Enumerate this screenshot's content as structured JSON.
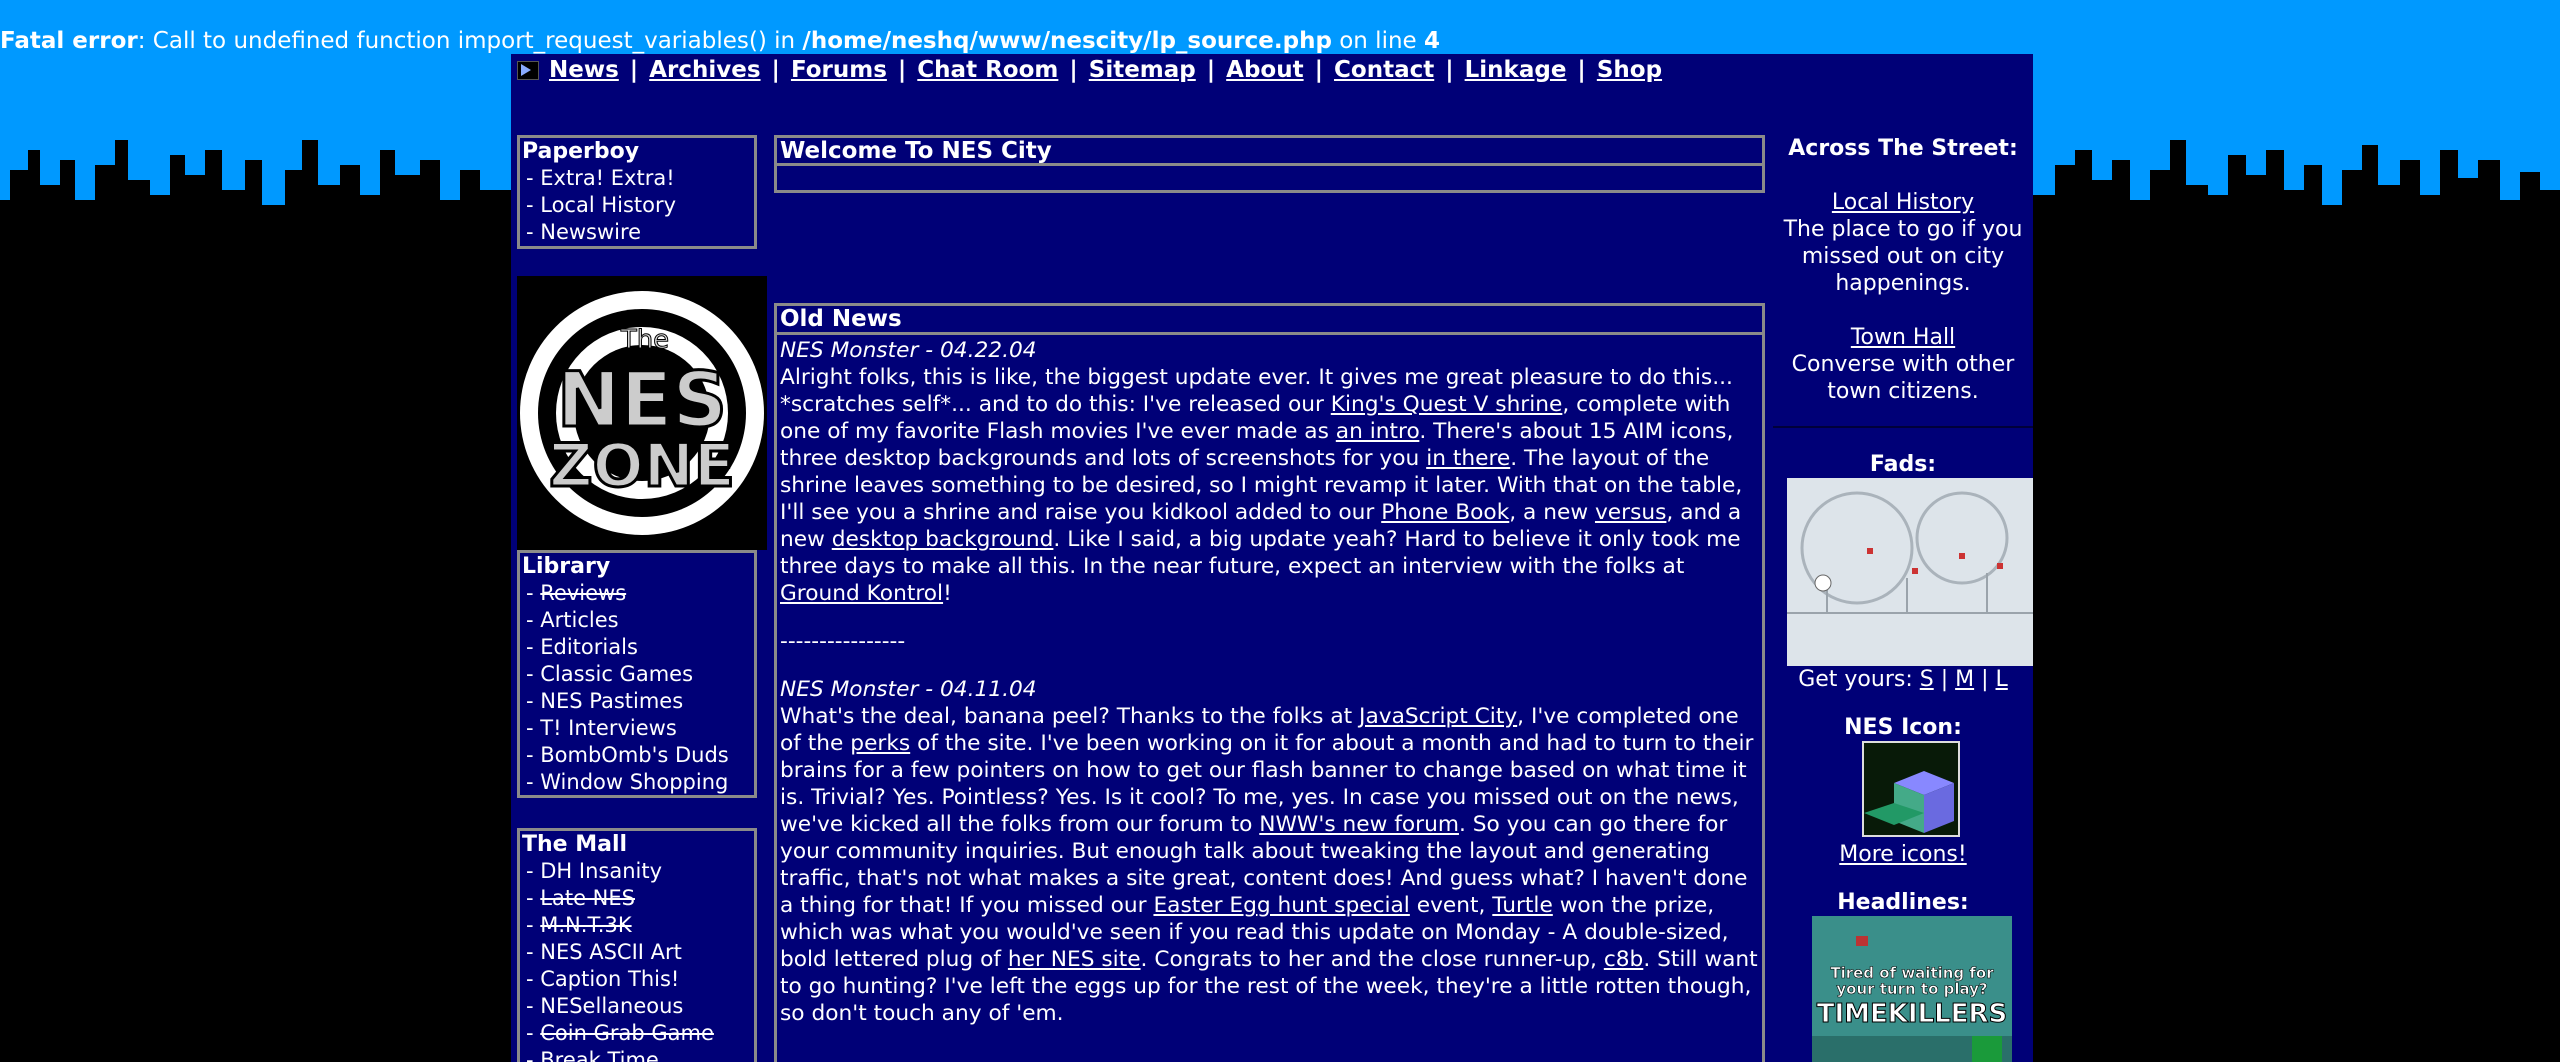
{
  "error": {
    "prefix": "Fatal error",
    "message": ": Call to undefined function import_request_variables() in ",
    "file": "/home/neshq/www/nescity/lp_source.php",
    "online": " on line ",
    "line": "4"
  },
  "nav": [
    "News",
    "Archives",
    "Forums",
    "Chat Room",
    "Sitemap",
    "About",
    "Contact",
    "Linkage",
    "Shop"
  ],
  "paperboy": {
    "title": "Paperboy",
    "items": [
      "- Extra! Extra!",
      "- Local History",
      "- Newswire"
    ]
  },
  "logo": {
    "line1": "The",
    "line2": "NES",
    "line3": "ZONE"
  },
  "library": {
    "title": "Library",
    "items": [
      "- ",
      "Reviews",
      "- Articles",
      "- Editorials",
      "- Classic Games",
      "- NES Pastimes",
      "- T! Interviews",
      "- BombOmb's Duds",
      "- Window Shopping"
    ]
  },
  "mall": {
    "title": "The Mall",
    "items": [
      "- DH Insanity",
      "- ",
      "Late NES",
      "- ",
      "M.N.T.3K",
      "- NES ASCII Art",
      "- Caption This!",
      "- NESellaneous",
      "- ",
      "Coin Grab Game",
      "- Break Time"
    ]
  },
  "welcome": {
    "title": "Welcome To NES City"
  },
  "oldnews": {
    "title": "Old News"
  },
  "post1": {
    "head": "NES Monster - 04.22.04",
    "t1": "Alright folks, this is like, the biggest update ever. It gives me great pleasure to do this... *scratches self*... and to do this: I've released our ",
    "l1": "King's Quest V shrine",
    "t2": ", complete with one of my favorite Flash movies I've ever made as ",
    "l2": "an intro",
    "t3": ". There's about 15 AIM icons, three desktop backgrounds and lots of screenshots for you ",
    "l3": "in there",
    "t4": ". The layout of the shrine leaves something to be desired, so I might revamp it later. With that on the table, I'll see you a shrine and raise you kidkool added to our ",
    "l4": "Phone Book",
    "t5": ", a new ",
    "l5": "versus",
    "t6": ", and a new ",
    "l6": "desktop background",
    "t7": ". Like I said, a big update yeah? Hard to believe it only took me three days to make all this. In the near future, expect an interview with the folks at ",
    "l7": "Ground Kontrol",
    "t8": "!"
  },
  "divider": "----------------",
  "post2": {
    "head": "NES Monster - 04.11.04",
    "t1": "What's the deal, banana peel? Thanks to the folks at ",
    "l1": "JavaScript City",
    "t2": ", I've completed one of the ",
    "l2": "perks",
    "t3": " of the site. I've been working on it for about a month and had to turn to their brains for a few pointers on how to get our flash banner to change based on what time it is. Trivial? Yes. Pointless? Yes. Is it cool? To me, yes. In case you missed out on the news, we've kicked all the folks from our forum to ",
    "l3": "NWW's new forum",
    "t4": ". So you can go there for your community inquiries. But enough talk about tweaking the layout and generating traffic, that's not what makes a site great, content does! And guess what? I haven't done a thing for that! If you missed our ",
    "l4": "Easter Egg hunt special",
    "t5": " event, ",
    "l5": "Turtle",
    "t6": " won the prize, which was what you would've seen if you read this update on Monday - A double-sized, bold lettered plug of ",
    "l6": "her NES site",
    "t7": ". Congrats to her and the close runner-up, ",
    "l7": "c8b",
    "t8": ". Still want to go hunting? I've left the eggs up for the rest of the week, they're a little rotten though, so don't touch any of 'em."
  },
  "right": {
    "across": "Across The Street:",
    "link1": "Local History",
    "desc1": "The place to go if you missed out on city happenings.",
    "link2": "Town Hall",
    "desc2": "Converse with other town citizens.",
    "fads": "Fads:",
    "getyours": "Get yours: ",
    "s": "S",
    "m": "M",
    "l": "L",
    "sep": " | ",
    "icon": "NES Icon:",
    "more": "More icons!",
    "headlines": "Headlines:",
    "ad1": "Tired of waiting for your turn to play?",
    "ad2": "TIMEKILLERS"
  }
}
